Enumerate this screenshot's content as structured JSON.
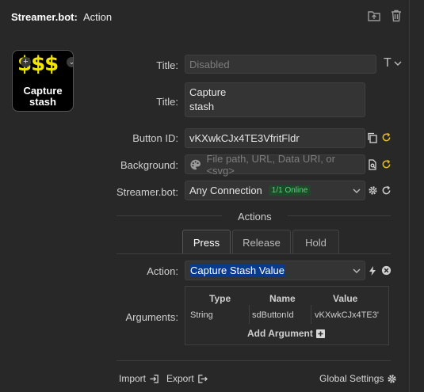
{
  "header": {
    "title": "Streamer.bot:",
    "subtitle": "Action",
    "folder_icon": "folder-icon",
    "trash_icon": "trash-icon"
  },
  "preview": {
    "dollars": "$$$",
    "text_line1": "Capture",
    "text_line2": "stash",
    "plus_glyph": "+",
    "chevron_glyph": "⌄"
  },
  "form": {
    "title_label_1": "Title:",
    "title_placeholder": "Disabled",
    "title_format_glyph": "T",
    "title_label_2": "Title:",
    "title_value_line1": "Capture",
    "title_value_line2": "stash",
    "button_id_label": "Button ID:",
    "button_id_value": "vKXwkCJx4TE3VfritFldr",
    "background_label": "Background:",
    "background_placeholder": "File path, URL, Data URI, or <svg>",
    "streamerbot_label": "Streamer.bot:",
    "connection_value": "Any Connection",
    "online_badge": "1/1 Online"
  },
  "actions": {
    "section_title": "Actions",
    "tabs": [
      {
        "label": "Press",
        "active": true
      },
      {
        "label": "Release",
        "active": false
      },
      {
        "label": "Hold",
        "active": false
      }
    ],
    "action_label": "Action:",
    "action_value": "Capture Stash Value",
    "arguments_label": "Arguments:",
    "columns": [
      "Type",
      "Name",
      "Value"
    ],
    "rows": [
      {
        "type": "String",
        "name": "sdButtonId",
        "value": "vKXwkCJx4TE3'"
      }
    ],
    "add_argument": "Add Argument"
  },
  "footer": {
    "import_label": "Import",
    "export_label": "Export",
    "global_settings_label": "Global Settings"
  },
  "colors": {
    "background": "#282828",
    "accent_yellow": "#e8c400",
    "online_green": "#5ed07a",
    "selection_blue": "#0a3a8c"
  }
}
